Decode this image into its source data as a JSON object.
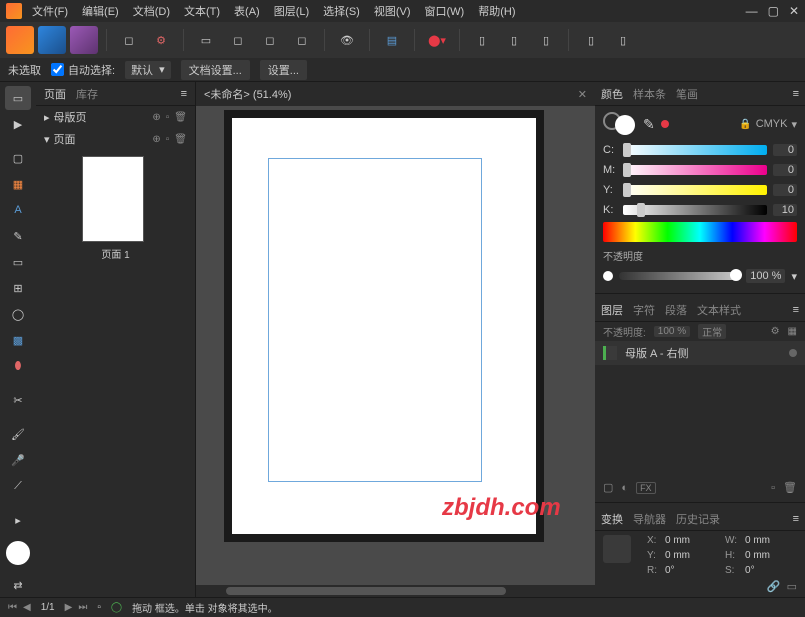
{
  "menu": {
    "file": "文件(F)",
    "edit": "编辑(E)",
    "doc": "文档(D)",
    "text": "文本(T)",
    "table": "表(A)",
    "layer": "图层(L)",
    "select": "选择(S)",
    "view": "视图(V)",
    "window": "窗口(W)",
    "help": "帮助(H)"
  },
  "contextbar": {
    "unselected": "未选取",
    "autoSelect": "自动选择:",
    "autoSelectValue": "默认",
    "docSettings": "文档设置...",
    "settings": "设置..."
  },
  "pagesPanel": {
    "tab1": "页面",
    "tab2": "库存",
    "master": "母版页",
    "pages": "页面",
    "thumbLabel": "页面 1"
  },
  "docTab": {
    "title": "<未命名> (51.4%)"
  },
  "watermark": "zbjdh.com",
  "colorPanel": {
    "tab1": "颜色",
    "tab2": "样本条",
    "tab3": "笔画",
    "mode": "CMYK",
    "c": {
      "label": "C:",
      "value": "0"
    },
    "m": {
      "label": "M:",
      "value": "0"
    },
    "y": {
      "label": "Y:",
      "value": "0"
    },
    "k": {
      "label": "K:",
      "value": "10"
    },
    "opacityLabel": "不透明度",
    "opacityValue": "100 %"
  },
  "layersPanel": {
    "tab1": "图层",
    "tab2": "字符",
    "tab3": "段落",
    "tab4": "文本样式",
    "opacity": "不透明度:",
    "opacityValue": "100 %",
    "blend": "正常",
    "layerName": "母版 A - 右侧",
    "fx": "FX"
  },
  "transformPanel": {
    "tab1": "变换",
    "tab2": "导航器",
    "tab3": "历史记录",
    "x": {
      "label": "X:",
      "value": "0 mm"
    },
    "w": {
      "label": "W:",
      "value": "0 mm"
    },
    "y": {
      "label": "Y:",
      "value": "0 mm"
    },
    "h": {
      "label": "H:",
      "value": "0 mm"
    },
    "r": {
      "label": "R:",
      "value": "0°"
    },
    "s": {
      "label": "S:",
      "value": "0°"
    }
  },
  "statusbar": {
    "page": "1/1",
    "hint": "拖动 框选。单击 对象将其选中。"
  }
}
